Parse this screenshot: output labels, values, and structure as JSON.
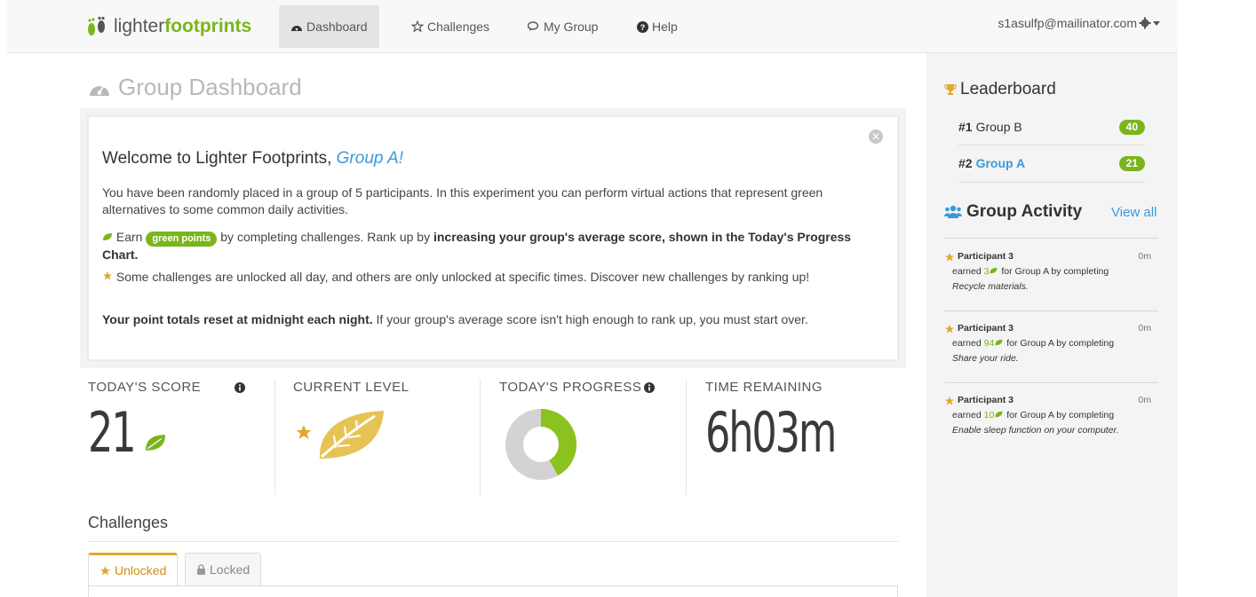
{
  "nav": {
    "brand_light": "lighter",
    "brand_bold": "footprints",
    "links": [
      {
        "label": "Dashboard",
        "icon": "dashboard-icon"
      },
      {
        "label": "Challenges",
        "icon": "star-outline-icon"
      },
      {
        "label": "My Group",
        "icon": "comments-icon"
      },
      {
        "label": "Help",
        "icon": "question-circle-icon"
      }
    ],
    "user_email": "s1asulfp@mailinator.com"
  },
  "page": {
    "title": "Group Dashboard"
  },
  "welcome": {
    "heading_prefix": "Welcome to Lighter Footprints, ",
    "group_name": "Group A!",
    "para1": "You have been randomly placed in a group of 5 participants. In this experiment you can perform virtual actions that represent green alternatives to some common daily activities.",
    "earn_text": "Earn",
    "pill": "green points",
    "earn_rest": "by completing challenges. Rank up by",
    "earn_bold": "increasing your group's average score, shown in the Today's Progress Chart.",
    "para3": "Some challenges are unlocked all day, and others are only unlocked at specific times. Discover new challenges by ranking up!",
    "para4_bold": "Your point totals reset at midnight each night.",
    "para4_rest": "If your group's average score isn't high enough to rank up, you must start over."
  },
  "metrics": {
    "score_label": "TODAY'S SCORE",
    "score_value": "21",
    "level_label": "CURRENT LEVEL",
    "progress_label": "TODAY'S PROGRESS",
    "progress_fraction": 0.42,
    "time_label": "TIME REMAINING",
    "time_value": "6h03m"
  },
  "challenges": {
    "heading": "Challenges",
    "tabs": [
      "Unlocked",
      "Locked"
    ]
  },
  "leaderboard": {
    "heading": "Leaderboard",
    "rows": [
      {
        "rank": "#1",
        "name": "Group B",
        "score": "40"
      },
      {
        "rank": "#2",
        "name": "Group A",
        "score": "21"
      }
    ]
  },
  "activity": {
    "heading": "Group Activity",
    "view_all": "View all",
    "items": [
      {
        "who": "Participant 3",
        "time": "0m",
        "earned": "earned",
        "points": "3",
        "for": "for Group A by completing",
        "challenge": "Recycle materials."
      },
      {
        "who": "Participant 3",
        "time": "0m",
        "earned": "earned",
        "points": "94",
        "for": "for Group A by completing",
        "challenge": "Share your ride."
      },
      {
        "who": "Participant 3",
        "time": "0m",
        "earned": "earned",
        "points": "10",
        "for": "for Group A by completing",
        "challenge": "Enable sleep function on your computer."
      }
    ]
  },
  "colors": {
    "brand_green": "#7ab51d",
    "link_blue": "#3a9ad9",
    "star_gold": "#e0a92b"
  }
}
